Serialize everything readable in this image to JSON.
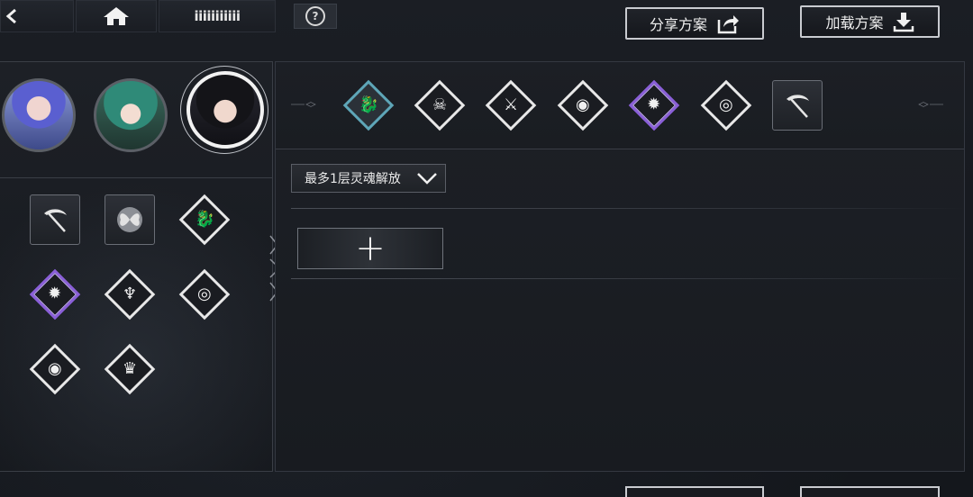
{
  "topbar": {
    "back_icon": "chevron-left-icon",
    "home_icon": "home-icon",
    "player_name": "iiiiiiiiiii",
    "help_label": "?"
  },
  "actions": {
    "share_label": "分享方案",
    "share_icon": "share-arrow-icon",
    "load_label": "加载方案",
    "load_icon": "download-icon"
  },
  "characters": [
    {
      "name": "character-blue-hair",
      "selected": false
    },
    {
      "name": "character-green-hair",
      "selected": false
    },
    {
      "name": "character-black-hair",
      "selected": true
    }
  ],
  "inventory_skills": [
    {
      "icon": "scythe-icon",
      "shape": "square"
    },
    {
      "icon": "butterfly-icon",
      "shape": "square"
    },
    {
      "icon": "dragon-icon",
      "shape": "diamond"
    },
    {
      "icon": "flame-crest-icon",
      "shape": "diamond",
      "accent": "#8a5fd8"
    },
    {
      "icon": "beast-crest-icon",
      "shape": "diamond"
    },
    {
      "icon": "spiral-icon",
      "shape": "diamond"
    },
    {
      "icon": "orb-icon",
      "shape": "diamond"
    },
    {
      "icon": "mask-icon",
      "shape": "diamond"
    }
  ],
  "skill_tabs": [
    {
      "icon": "dragon-icon",
      "active": true,
      "accent": "#5ea6b8"
    },
    {
      "icon": "demon-face-icon"
    },
    {
      "icon": "sword-crest-icon"
    },
    {
      "icon": "orb-icon"
    },
    {
      "icon": "flame-crest-icon",
      "accent": "#8a5fd8"
    },
    {
      "icon": "spiral-icon"
    },
    {
      "icon": "scythe-icon",
      "shape": "square"
    }
  ],
  "filter": {
    "selected": "最多1层灵魂解放",
    "chevron_icon": "chevron-down-icon"
  },
  "add_button": {
    "label": "+"
  }
}
